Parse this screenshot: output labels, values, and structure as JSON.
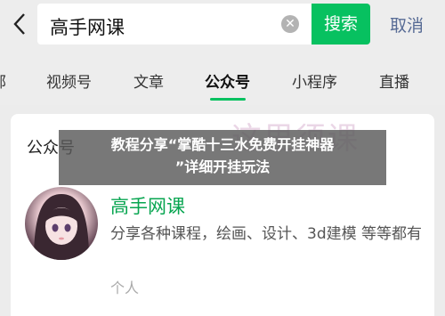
{
  "search": {
    "query": "高手网课",
    "button": "搜索",
    "cancel": "取消"
  },
  "tabs": [
    "部",
    "视频号",
    "文章",
    "公众号",
    "小程序",
    "直播"
  ],
  "active_tab": "公众号",
  "section_title": "公众号",
  "watermark": "这里须课",
  "account": {
    "name": "高手网课",
    "description": "分享各种课程，绘画、设计、3d建模 等等都有",
    "type": "个人"
  },
  "overlay": {
    "line1": "教程分享“掌酷十三水免费开挂神器",
    "line2": "”详细开挂玩法"
  },
  "colors": {
    "accent": "#07c160",
    "link": "#576b95"
  }
}
